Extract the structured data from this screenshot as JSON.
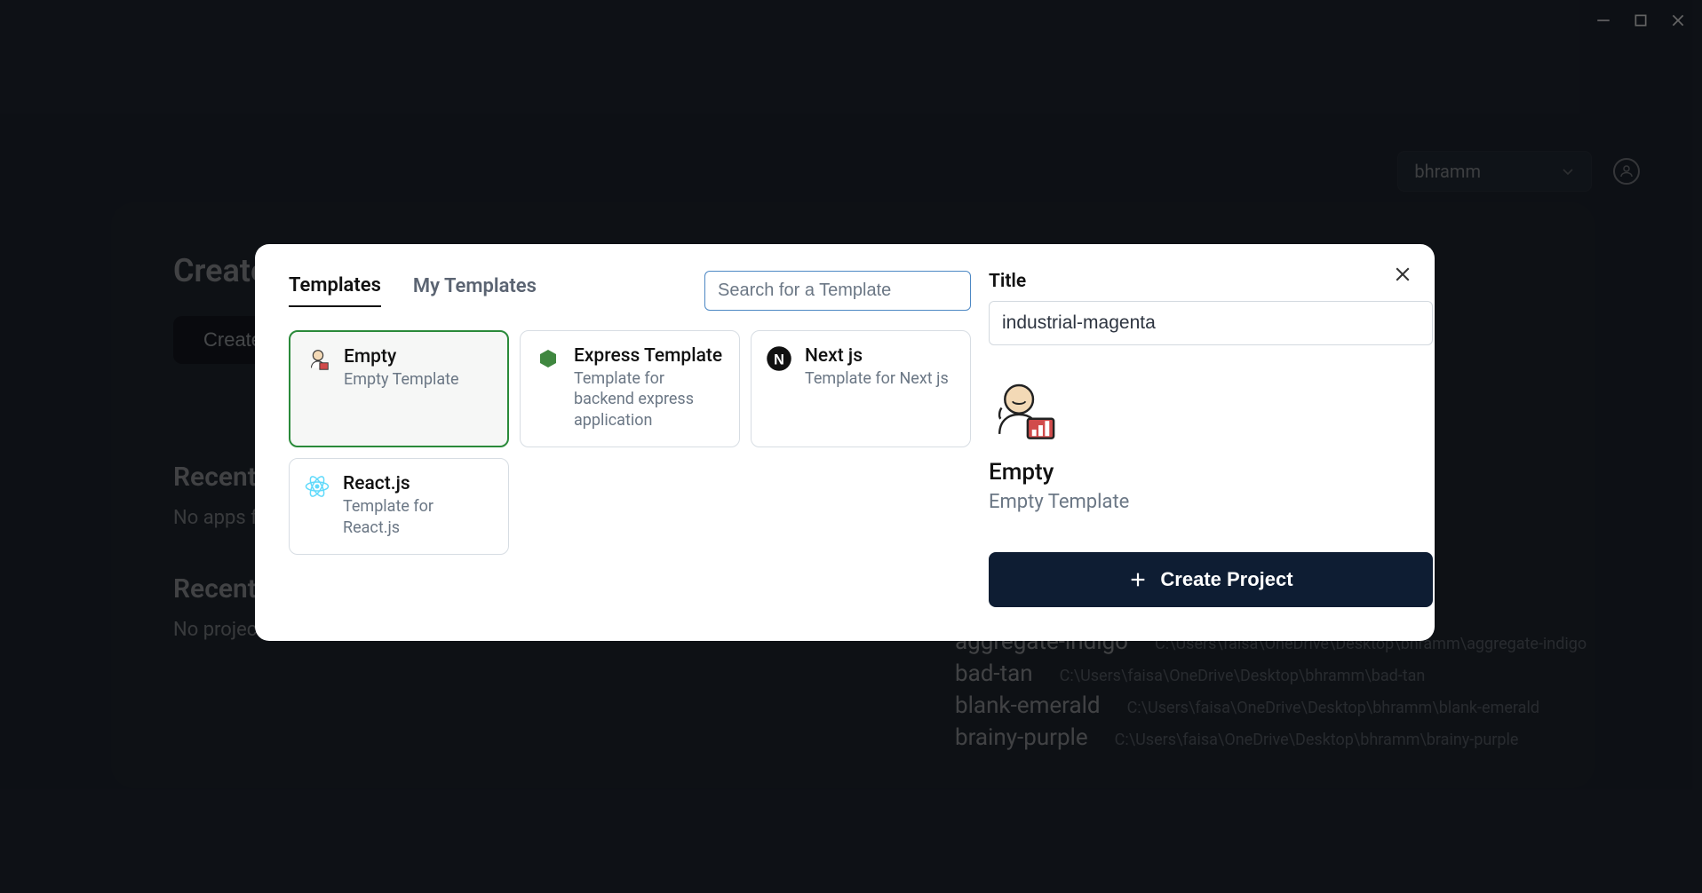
{
  "window": {
    "user": "bhramm"
  },
  "background": {
    "create_heading": "Create",
    "create_button": "Create",
    "recent_apps_heading": "Recent",
    "recent_apps_empty": "No apps fo",
    "recent_projects_heading": "Recent",
    "recent_projects_empty": "No project",
    "list": [
      {
        "name": "aggregate-indigo",
        "path": "C:\\Users\\faisa\\OneDrive\\Desktop\\bhramm\\aggregate-indigo"
      },
      {
        "name": "bad-tan",
        "path": "C:\\Users\\faisa\\OneDrive\\Desktop\\bhramm\\bad-tan"
      },
      {
        "name": "blank-emerald",
        "path": "C:\\Users\\faisa\\OneDrive\\Desktop\\bhramm\\blank-emerald"
      },
      {
        "name": "brainy-purple",
        "path": "C:\\Users\\faisa\\OneDrive\\Desktop\\bhramm\\brainy-purple"
      }
    ]
  },
  "modal": {
    "tabs": {
      "templates": "Templates",
      "my_templates": "My Templates"
    },
    "search_placeholder": "Search for a Template",
    "cards": [
      {
        "icon": "empty",
        "title": "Empty",
        "sub": "Empty Template",
        "selected": true
      },
      {
        "icon": "express",
        "title": "Express Template",
        "sub": "Template for backend express application",
        "selected": false
      },
      {
        "icon": "nextjs",
        "title": "Next js",
        "sub": "Template for Next js",
        "selected": false
      },
      {
        "icon": "react",
        "title": "React.js",
        "sub": "Template for React.js",
        "selected": false
      }
    ],
    "title_label": "Title",
    "title_value": "industrial-magenta",
    "preview": {
      "name": "Empty",
      "sub": "Empty Template"
    },
    "create_button": "Create Project"
  }
}
